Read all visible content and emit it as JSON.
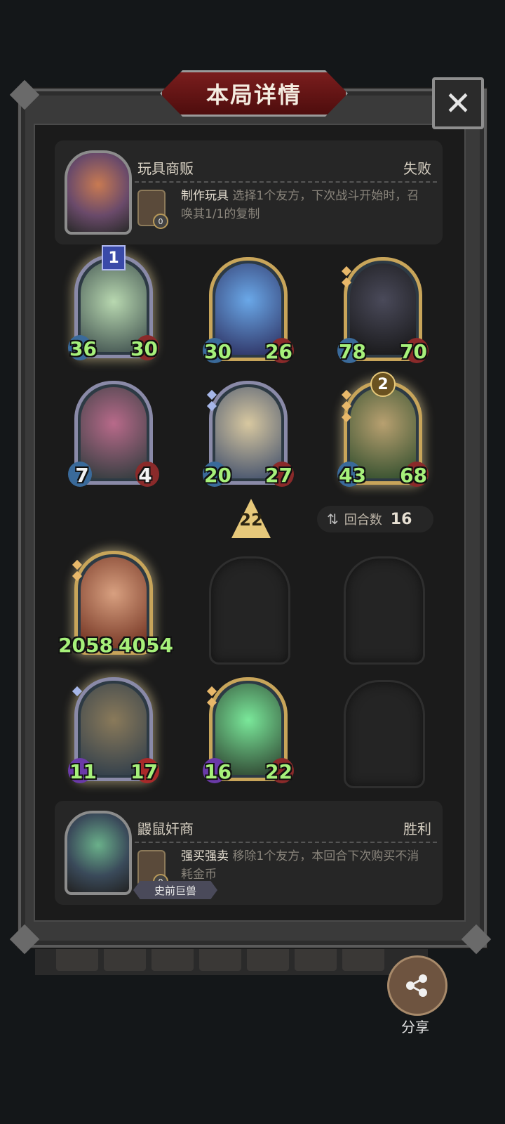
{
  "header": {
    "title": "本局详情"
  },
  "opponent": {
    "name": "玩具商贩",
    "result": "失败",
    "ability_name": "制作玩具",
    "ability_desc": "选择1个友方，下次战斗开始时，召唤其1/1的复制",
    "ability_cost": "0"
  },
  "opponent_board": [
    {
      "atk": "36",
      "hp": "30",
      "tier": "1"
    },
    {
      "atk": "30",
      "hp": "26"
    },
    {
      "atk": "78",
      "hp": "70"
    },
    {
      "atk": "7",
      "hp": "4"
    },
    {
      "atk": "20",
      "hp": "27"
    },
    {
      "atk": "43",
      "hp": "68",
      "tier": "2"
    }
  ],
  "level_arrow": "22",
  "turns": {
    "label": "回合数",
    "value": "16"
  },
  "player_board": [
    {
      "atk": "2058",
      "hp": "4054"
    },
    {
      "atk": "11",
      "hp": "17"
    },
    {
      "atk": "16",
      "hp": "22"
    }
  ],
  "player": {
    "name": "鼹鼠奸商",
    "result": "胜利",
    "ability_name": "强买强卖",
    "ability_desc": "移除1个友方，本回合下次购买不消耗金币",
    "ability_cost": "0",
    "tribe": "史前巨兽"
  },
  "share": {
    "label": "分享",
    "icon": "share-icon"
  },
  "close": {
    "icon": "close-icon",
    "glyph": "✕"
  },
  "colors": {
    "stat_green": "#a6f07a",
    "title_red": "#7a1d1d",
    "gold_border": "#c8a55a"
  }
}
